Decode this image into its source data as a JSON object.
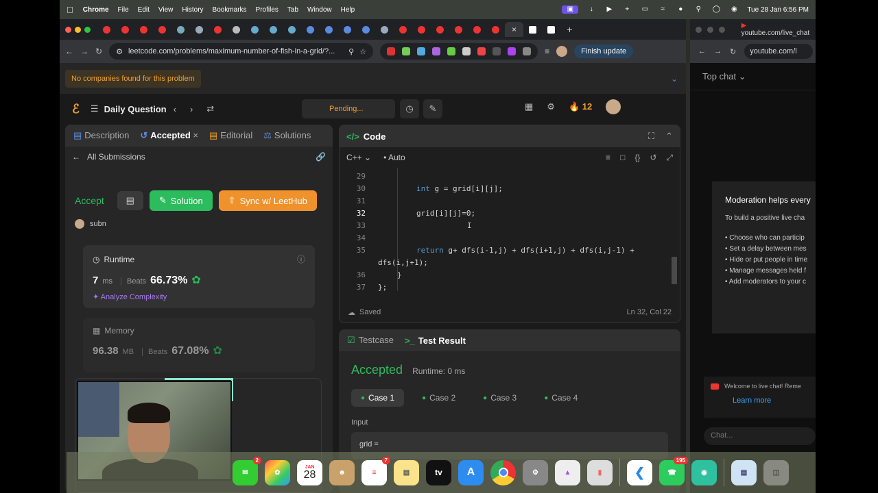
{
  "menubar": {
    "app": "Chrome",
    "items": [
      "File",
      "Edit",
      "View",
      "History",
      "Bookmarks",
      "Profiles",
      "Tab",
      "Window",
      "Help"
    ],
    "datetime": "Tue 28 Jan  6:56 PM"
  },
  "browser": {
    "url": "leetcode.com/problems/maximum-number-of-fish-in-a-grid/?...",
    "finish_update": "Finish update"
  },
  "leetcode": {
    "banner": "No companies found for this problem",
    "nav_title": "Daily Question",
    "pending": "Pending...",
    "streak": "12",
    "left_tabs": [
      "Description",
      "Accepted",
      "Editorial",
      "Solutions"
    ],
    "all_submissions": "All Submissions",
    "accept_label": "Accept",
    "solution_btn": "Solution",
    "sync_btn": "Sync w/ LeetHub",
    "user": "subn",
    "runtime": {
      "title": "Runtime",
      "value": "7",
      "unit": "ms",
      "beats_label": "Beats",
      "beats": "66.73%",
      "analyze": "Analyze Complexity"
    },
    "memory": {
      "title": "Memory",
      "value": "96.38",
      "unit": "MB",
      "beats_label": "Beats",
      "beats": "67.08%"
    },
    "code_panel": {
      "title": "Code",
      "lang": "C++",
      "mode": "Auto",
      "saved": "Saved",
      "cursor_pos": "Ln 32, Col 22",
      "lines": [
        {
          "n": "29",
          "text": ""
        },
        {
          "n": "30",
          "kw": "int",
          "text": " g = grid[i][j];"
        },
        {
          "n": "31",
          "text": ""
        },
        {
          "n": "32",
          "text": "grid[i][j]=0;"
        },
        {
          "n": "33",
          "text": ""
        },
        {
          "n": "34",
          "text": ""
        },
        {
          "n": "35",
          "kw": "return",
          "text": " g+ dfs(i-1,j) + dfs(i+1,j) + dfs(i,j-1) +"
        },
        {
          "n": "",
          "text": "dfs(i,j+1);"
        },
        {
          "n": "36",
          "text": "}"
        },
        {
          "n": "37",
          "text": "};"
        }
      ]
    },
    "test_panel": {
      "tabs": [
        "Testcase",
        "Test Result"
      ],
      "status": "Accepted",
      "runtime": "Runtime: 0 ms",
      "cases": [
        "Case 1",
        "Case 2",
        "Case 3",
        "Case 4"
      ],
      "input_label": "Input",
      "input_value": "grid ="
    }
  },
  "youtube": {
    "tab_title": "youtube.com/live_chat",
    "url": "youtube.com/l",
    "top_chat": "Top chat",
    "moderation_title": "Moderation helps every",
    "moderation_intro": "To build a positive live cha",
    "moderation_items": [
      "• Choose who can particip",
      "• Set a delay between mes",
      "• Hide or put people in time",
      "• Manage messages held f",
      "• Add moderators to your c"
    ],
    "welcome": "Welcome to live chat! Reme",
    "learn_more": "Learn more",
    "chat_placeholder": "Chat..."
  },
  "dock": {
    "badges": {
      "messages": "2",
      "reminders": "7",
      "whatsapp": "195"
    },
    "calendar_month": "JAN",
    "calendar_day": "28",
    "tv_label": "tv"
  }
}
